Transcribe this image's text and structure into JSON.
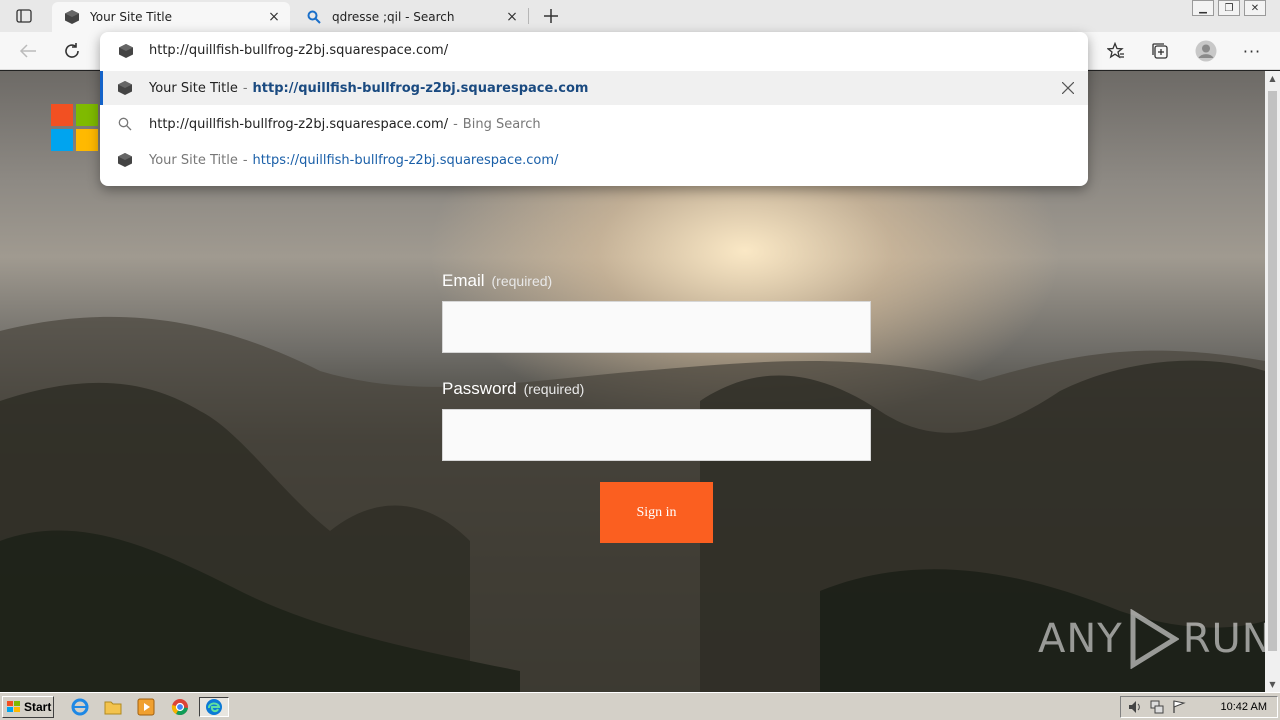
{
  "browser": {
    "tabs": [
      {
        "title": "Your Site Title",
        "close": "×",
        "active": true
      },
      {
        "title": "qdresse ;qil - Search",
        "close": "×",
        "active": false
      }
    ],
    "new_tab": "+",
    "address": "http://quillfish-bullfrog-z2bj.squarespace.com/",
    "suggestions": [
      {
        "title": "Your Site Title",
        "sep": "-",
        "url": "http://quillfish-bullfrog-z2bj.squarespace.com"
      },
      {
        "query": "http://quillfish-bullfrog-z2bj.squarespace.com/",
        "sep": "-",
        "engine": "Bing Search"
      },
      {
        "title": "Your Site Title",
        "sep": "-",
        "url": "https://quillfish-bullfrog-z2bj.squarespace.com/"
      }
    ]
  },
  "page": {
    "email_label": "Email",
    "email_required": "(required)",
    "password_label": "Password",
    "password_required": "(required)",
    "signin_label": "Sign in",
    "watermark": "ANY",
    "watermark_run": "RUN"
  },
  "taskbar": {
    "start_label": "Start",
    "clock": "10:42 AM"
  }
}
